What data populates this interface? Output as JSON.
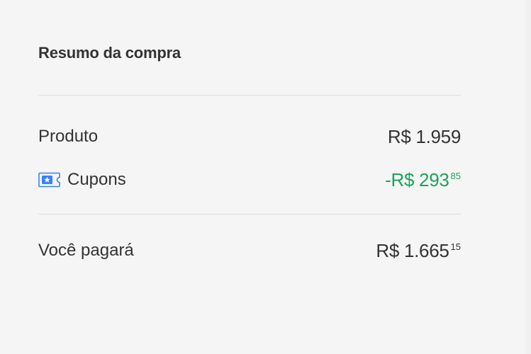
{
  "summary": {
    "title": "Resumo da compra",
    "rows": [
      {
        "label": "Produto",
        "amount": "R$ 1.959",
        "cents": ""
      },
      {
        "label": "Cupons",
        "icon": "coupon-ticket-icon",
        "amount": "-R$ 293",
        "cents": "85",
        "color": "#1aa35b"
      },
      {
        "label": "Você pagará",
        "amount": "R$ 1.665",
        "cents": "15"
      }
    ]
  },
  "colors": {
    "background": "#f5f5f5",
    "text": "#333333",
    "discount": "#1aa35b",
    "coupon_icon": "#3483fa",
    "divider": "#dddddd"
  }
}
